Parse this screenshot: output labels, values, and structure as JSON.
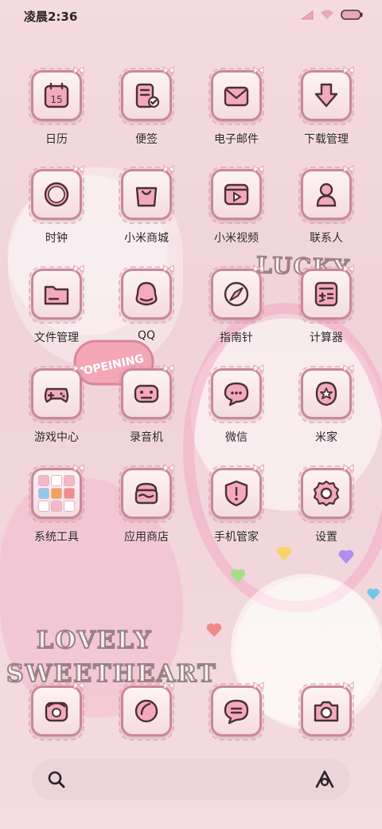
{
  "status_bar": {
    "time": "凌晨2:36"
  },
  "wallpaper": {
    "sticker_lucky": "LUCKY",
    "sticker_lovely": "LOVELY",
    "sticker_sweetheart": "SWEETHEART",
    "sign_opening": "OPEINING"
  },
  "apps": [
    {
      "label": "日历",
      "icon": "calendar-icon",
      "glyph_text": "15"
    },
    {
      "label": "便签",
      "icon": "notes-icon"
    },
    {
      "label": "电子邮件",
      "icon": "mail-icon"
    },
    {
      "label": "下载管理",
      "icon": "download-icon"
    },
    {
      "label": "时钟",
      "icon": "clock-icon"
    },
    {
      "label": "小米商城",
      "icon": "shopping-bag-icon"
    },
    {
      "label": "小米视频",
      "icon": "video-icon"
    },
    {
      "label": "联系人",
      "icon": "contacts-icon"
    },
    {
      "label": "文件管理",
      "icon": "folder-icon"
    },
    {
      "label": "QQ",
      "icon": "qq-icon"
    },
    {
      "label": "指南针",
      "icon": "compass-icon"
    },
    {
      "label": "计算器",
      "icon": "calculator-icon"
    },
    {
      "label": "游戏中心",
      "icon": "gamepad-icon"
    },
    {
      "label": "录音机",
      "icon": "recorder-icon"
    },
    {
      "label": "微信",
      "icon": "wechat-icon"
    },
    {
      "label": "米家",
      "icon": "mijia-icon"
    },
    {
      "label": "系统工具",
      "icon": "folder-tools-icon"
    },
    {
      "label": "应用商店",
      "icon": "app-store-icon"
    },
    {
      "label": "手机管家",
      "icon": "security-icon"
    },
    {
      "label": "设置",
      "icon": "settings-icon"
    }
  ],
  "dock": [
    {
      "icon": "phone-icon"
    },
    {
      "icon": "browser-icon"
    },
    {
      "icon": "messages-icon"
    },
    {
      "icon": "camera-icon"
    }
  ],
  "search": {
    "search_icon": "search-icon",
    "assistant_icon": "assistant-icon"
  },
  "colors": {
    "tile_border": "#c98897",
    "glyph_fill": "#f3a9bf",
    "glyph_stroke": "#4a3035",
    "accent_pink": "#f4aac4"
  }
}
